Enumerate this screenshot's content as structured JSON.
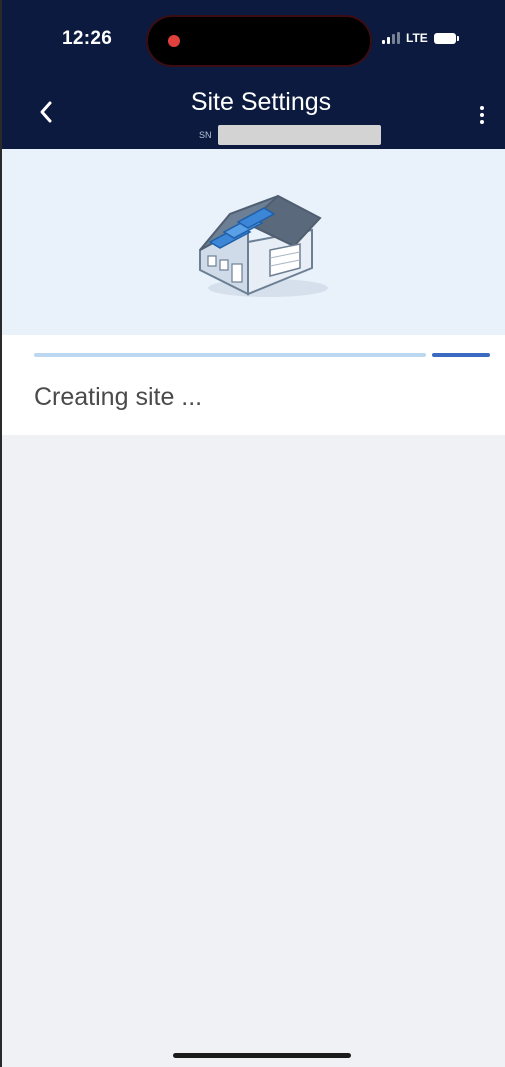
{
  "status_bar": {
    "time": "12:26",
    "network": "LTE",
    "icons": [
      "recording-dot-icon",
      "signal-icon",
      "battery-icon"
    ]
  },
  "header": {
    "title": "Site Settings",
    "subtitle_label": "SN",
    "subtitle_value_redacted": true,
    "back_icon": "chevron-left-icon",
    "more_icon": "more-vertical-icon",
    "background_color": "#0b1a3e"
  },
  "hero": {
    "illustration": "house-with-solar-panels",
    "background_color": "#e9f1fa"
  },
  "progress": {
    "indeterminate": true,
    "track_color": "#bcd7f0",
    "indicator_color": "#3a6bc1",
    "status_text": "Creating site ..."
  },
  "colors": {
    "page_background": "#eff1f5",
    "card_background": "#ffffff"
  }
}
